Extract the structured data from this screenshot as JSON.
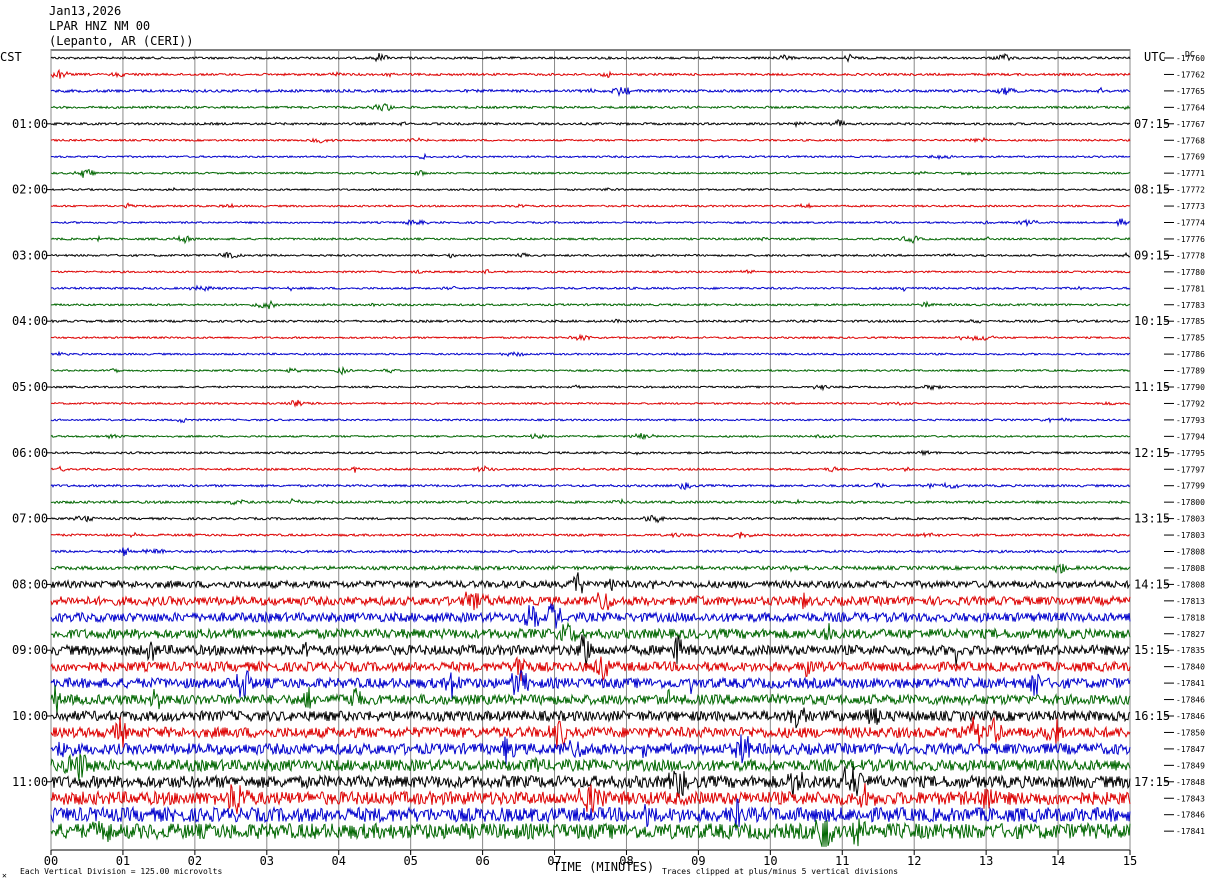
{
  "header": {
    "date": "Jan13,2026",
    "station": "LPAR HNZ NM 00",
    "location": "(Lepanto, AR (CERI))"
  },
  "left_tz": "CST",
  "right_tz": "UTC",
  "dc_label": "DC",
  "footer": {
    "scale": "Each Vertical Division = 125.00 microvolts",
    "clip": "Traces clipped at plus/minus 5 vertical divisions",
    "corner": "✕"
  },
  "chart_data": {
    "type": "line",
    "title": "",
    "xlabel": "TIME (MINUTES)",
    "ylabel": "",
    "xlim": [
      0,
      15
    ],
    "x_ticks": [
      "00",
      "01",
      "02",
      "03",
      "04",
      "05",
      "06",
      "07",
      "08",
      "09",
      "10",
      "11",
      "12",
      "13",
      "14",
      "15"
    ],
    "left_hour_labels": [
      "01:00",
      "02:00",
      "03:00",
      "04:00",
      "05:00",
      "06:00",
      "07:00",
      "08:00",
      "09:00",
      "10:00",
      "11:00"
    ],
    "right_hour_labels": [
      "07:15",
      "08:15",
      "09:15",
      "10:15",
      "11:15",
      "12:15",
      "13:15",
      "14:15",
      "15:15",
      "16:15",
      "17:15"
    ],
    "trace_colors": [
      "#000000",
      "#dd0000",
      "#0000cc",
      "#006600"
    ],
    "dc_offsets": [
      "-17760",
      "-17762",
      "-17765",
      "-17764",
      "-17767",
      "-17768",
      "-17769",
      "-17771",
      "-17772",
      "-17773",
      "-17774",
      "-17776",
      "-17778",
      "-17780",
      "-17781",
      "-17783",
      "-17785",
      "-17785",
      "-17786",
      "-17789",
      "-17790",
      "-17792",
      "-17793",
      "-17794",
      "-17795",
      "-17797",
      "-17799",
      "-17800",
      "-17803",
      "-17803",
      "-17808",
      "-17808",
      "-17808",
      "-17813",
      "-17818",
      "-17827",
      "-17835",
      "-17840",
      "-17841",
      "-17846",
      "-17846",
      "-17850",
      "-17847",
      "-17849",
      "-17848",
      "-17843",
      "-17846",
      "-17841"
    ],
    "noise_level": [
      1,
      1,
      1.2,
      1,
      1,
      0.8,
      0.8,
      0.8,
      0.8,
      0.8,
      0.8,
      0.9,
      0.9,
      0.8,
      0.9,
      0.9,
      1,
      0.8,
      0.8,
      0.8,
      0.8,
      0.8,
      0.8,
      0.8,
      0.9,
      0.9,
      1,
      1.1,
      1,
      1,
      1.1,
      1.6,
      3.2,
      4,
      4.2,
      4.4,
      4.5,
      4.3,
      4.6,
      4.5,
      4.6,
      4.8,
      5,
      5.2,
      5.5,
      6,
      6.5,
      7
    ]
  }
}
